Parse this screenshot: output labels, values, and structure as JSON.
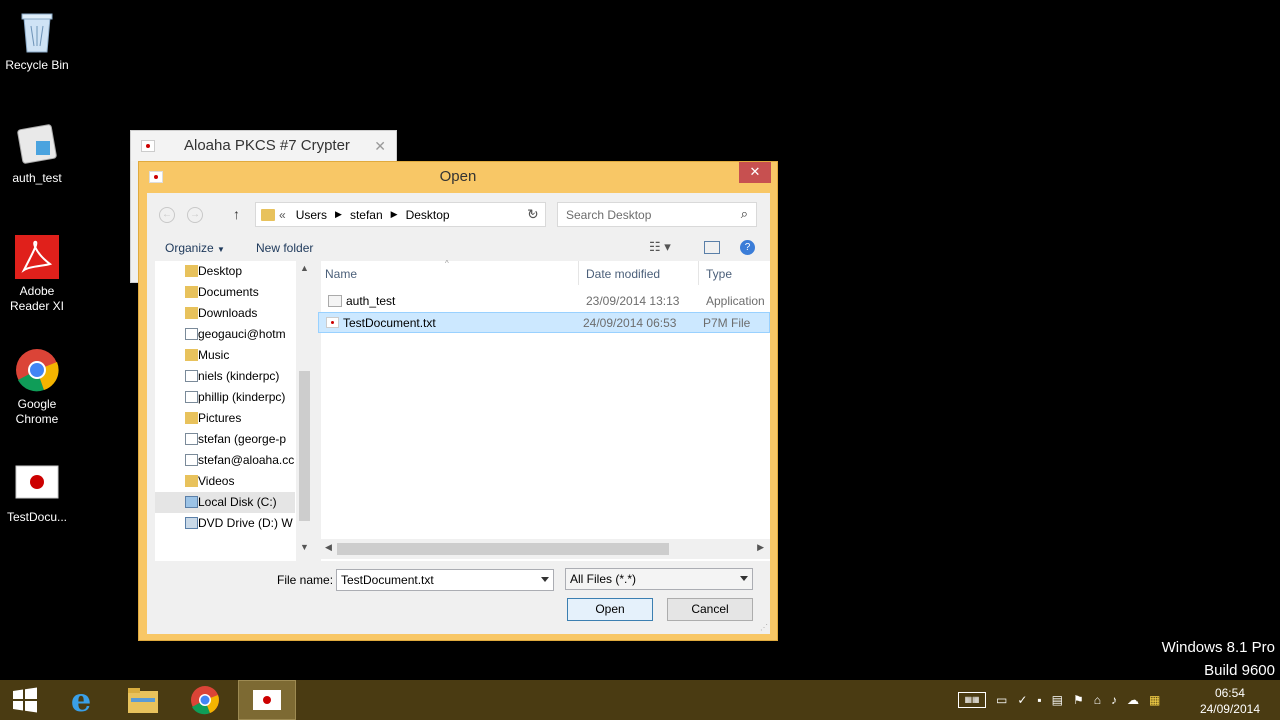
{
  "desktop": {
    "icons": [
      {
        "label": "Recycle Bin"
      },
      {
        "label": "auth_test"
      },
      {
        "label": "Adobe Reader XI"
      },
      {
        "label": "Google Chrome"
      },
      {
        "label": "TestDocu..."
      }
    ],
    "watermark": {
      "line1": "Windows 8.1 Pro",
      "line2": "Build 9600"
    }
  },
  "bg_app": {
    "title": "Aloaha PKCS #7 Crypter"
  },
  "dialog": {
    "title": "Open",
    "close_glyph": "✕",
    "breadcrumb": {
      "prefix": "«",
      "parts": [
        "Users",
        "stefan",
        "Desktop"
      ]
    },
    "search_placeholder": "Search Desktop",
    "organize_label": "Organize",
    "new_folder_label": "New folder",
    "nav_items": [
      {
        "label": "Desktop",
        "icon": "folder-icon"
      },
      {
        "label": "Documents",
        "icon": "folder-icon"
      },
      {
        "label": "Downloads",
        "icon": "folder-icon"
      },
      {
        "label": "geogauci@hotm",
        "icon": "network-folder-icon"
      },
      {
        "label": "Music",
        "icon": "folder-icon"
      },
      {
        "label": "niels (kinderpc)",
        "icon": "network-folder-icon"
      },
      {
        "label": "phillip (kinderpc)",
        "icon": "network-folder-icon"
      },
      {
        "label": "Pictures",
        "icon": "folder-icon"
      },
      {
        "label": "stefan (george-p",
        "icon": "network-folder-icon"
      },
      {
        "label": "stefan@aloaha.cc",
        "icon": "network-folder-icon"
      },
      {
        "label": "Videos",
        "icon": "folder-icon"
      },
      {
        "label": "Local Disk (C:)",
        "icon": "drive-icon"
      },
      {
        "label": "DVD Drive (D:) W",
        "icon": "dvd-icon"
      }
    ],
    "columns": {
      "name": "Name",
      "date": "Date modified",
      "type": "Type"
    },
    "files": [
      {
        "name": "auth_test",
        "date": "23/09/2014 13:13",
        "type": "Application"
      },
      {
        "name": "TestDocument.txt",
        "date": "24/09/2014 06:53",
        "type": "P7M File"
      }
    ],
    "filename_label": "File name:",
    "filename_value": "TestDocument.txt",
    "filter_value": "All Files (*.*)",
    "open_label": "Open",
    "cancel_label": "Cancel"
  },
  "taskbar": {
    "time": "06:54",
    "date": "24/09/2014"
  },
  "colors": {
    "dialog_frame": "#f8c766",
    "close": "#c75050",
    "taskbar": "#4a3b12",
    "selection": "#cce8ff"
  }
}
